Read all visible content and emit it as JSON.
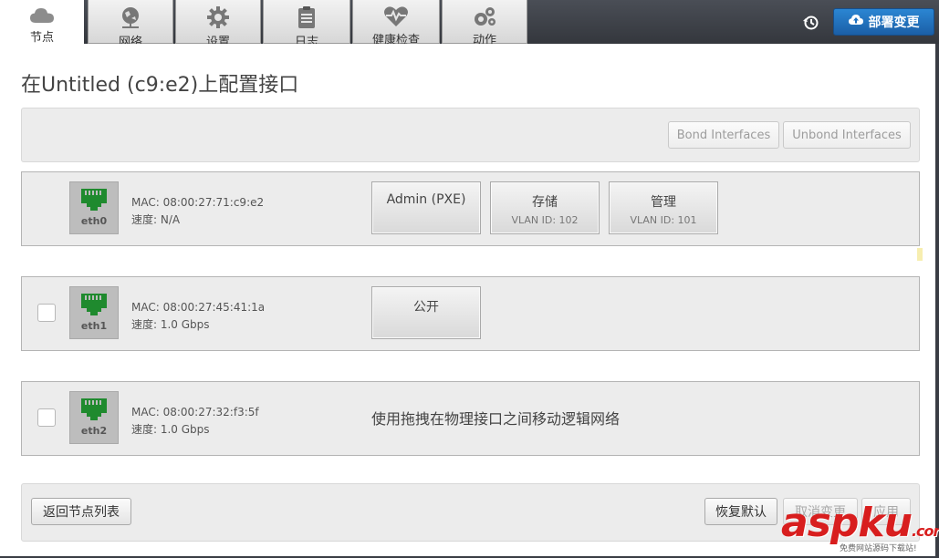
{
  "tabs": [
    {
      "label": "节点",
      "icon": "cloud-icon"
    },
    {
      "label": "网络",
      "icon": "globe-network-icon"
    },
    {
      "label": "设置",
      "icon": "gear-icon"
    },
    {
      "label": "日志",
      "icon": "clipboard-icon"
    },
    {
      "label": "健康检查",
      "icon": "heart-pulse-icon"
    },
    {
      "label": "动作",
      "icon": "cogs-icon"
    }
  ],
  "header": {
    "deploy_label": "部署变更"
  },
  "page": {
    "title": "在Untitled (c9:e2)上配置接口"
  },
  "bond_bar": {
    "bond_label": "Bond Interfaces",
    "unbond_label": "Unbond Interfaces"
  },
  "interfaces": [
    {
      "name": "eth0",
      "mac": "MAC: 08:00:27:71:c9:e2",
      "speed": "速度: N/A",
      "networks": [
        {
          "name": "Admin (PXE)",
          "vlan": ""
        },
        {
          "name": "存储",
          "vlan": "VLAN ID: 102"
        },
        {
          "name": "管理",
          "vlan": "VLAN ID: 101"
        }
      ]
    },
    {
      "name": "eth1",
      "mac": "MAC: 08:00:27:45:41:1a",
      "speed": "速度: 1.0 Gbps",
      "networks": [
        {
          "name": "公开",
          "vlan": ""
        }
      ]
    },
    {
      "name": "eth2",
      "mac": "MAC: 08:00:27:32:f3:5f",
      "speed": "速度: 1.0 Gbps",
      "hint": "使用拖拽在物理接口之间移动逻辑网络"
    }
  ],
  "footer": {
    "back_label": "返回节点列表",
    "reset_label": "恢复默认",
    "cancel_label": "取消变更",
    "apply_label": "应用"
  },
  "watermark": {
    "brand": "aspku",
    "suffix": ".com",
    "sub": "免费网站源码下载站!"
  },
  "colors": {
    "accent": "#1b6fc0",
    "port_green": "#1f8a2e",
    "watermark_red": "#d81e1e"
  }
}
